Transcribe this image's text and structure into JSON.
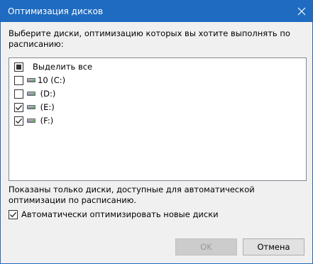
{
  "window": {
    "title": "Оптимизация дисков",
    "close_icon": "close-icon"
  },
  "instruction": "Выберите диски, оптимизацию которых вы хотите выполнять по расписанию:",
  "drive_list": {
    "select_all": {
      "label": "Выделить все",
      "state": "partial"
    },
    "items": [
      {
        "label": "10 (C:)",
        "checked": false,
        "icon": "drive-icon"
      },
      {
        "label": " (D:)",
        "checked": false,
        "icon": "drive-icon"
      },
      {
        "label": " (E:)",
        "checked": true,
        "icon": "drive-icon"
      },
      {
        "label": " (F:)",
        "checked": true,
        "icon": "drive-icon"
      }
    ]
  },
  "note": "Показаны только диски, доступные для автоматической оптимизации по расписанию.",
  "auto_optimize": {
    "label": "Автоматически оптимизировать новые диски",
    "checked": true
  },
  "buttons": {
    "ok": "OK",
    "cancel": "Отмена"
  },
  "colors": {
    "titlebar": "#1f6bc1",
    "dialog_bg": "#f0f0f0"
  }
}
